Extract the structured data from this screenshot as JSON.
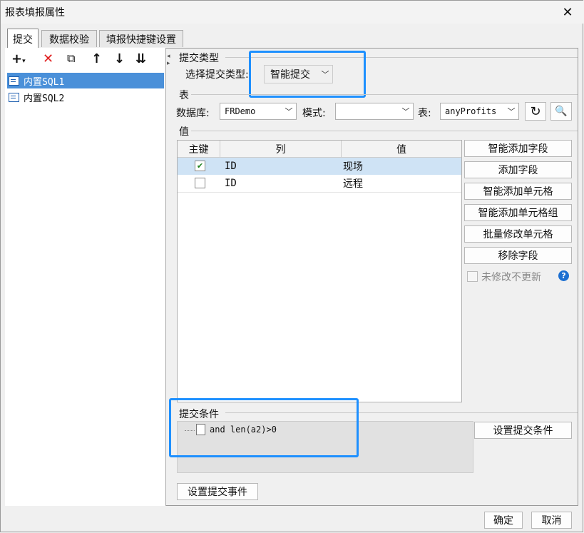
{
  "window": {
    "title": "报表填报属性"
  },
  "tabs": [
    {
      "label": "提交"
    },
    {
      "label": "数据校验"
    },
    {
      "label": "填报快捷键设置"
    }
  ],
  "toolbar": {
    "icons": [
      "add-icon",
      "delete-icon",
      "copy-icon",
      "move-up-icon",
      "move-down-icon",
      "move-bottom-icon"
    ]
  },
  "tree": {
    "items": [
      {
        "label": "内置SQL1"
      },
      {
        "label": "内置SQL2"
      }
    ]
  },
  "submit_type": {
    "section": "提交类型",
    "label": "选择提交类型:",
    "value": "智能提交"
  },
  "table_section": {
    "section": "表",
    "db_label": "数据库:",
    "db_value": "FRDemo",
    "mode_label": "模式:",
    "mode_value": "",
    "table_label": "表:",
    "table_value": "anyProfits"
  },
  "values": {
    "section": "值",
    "headers": [
      "主键",
      "列",
      "值"
    ],
    "rows": [
      {
        "key": true,
        "column": "ID",
        "value": "现场"
      },
      {
        "key": false,
        "column": "ID",
        "value": "远程"
      }
    ],
    "buttons": {
      "smart_add_field": "智能添加字段",
      "add_field": "添加字段",
      "smart_add_cell": "智能添加单元格",
      "smart_add_cell_group": "智能添加单元格组",
      "batch_modify_cell": "批量修改单元格",
      "remove_field": "移除字段"
    },
    "no_update_label": "未修改不更新"
  },
  "condition": {
    "section": "提交条件",
    "expression": "and len(a2)>0",
    "set_button": "设置提交条件"
  },
  "event_button": "设置提交事件",
  "footer": {
    "ok": "确定",
    "cancel": "取消"
  },
  "colors": {
    "accent": "#1e90ff",
    "selection": "#4a90d9",
    "delete": "#e02020"
  }
}
